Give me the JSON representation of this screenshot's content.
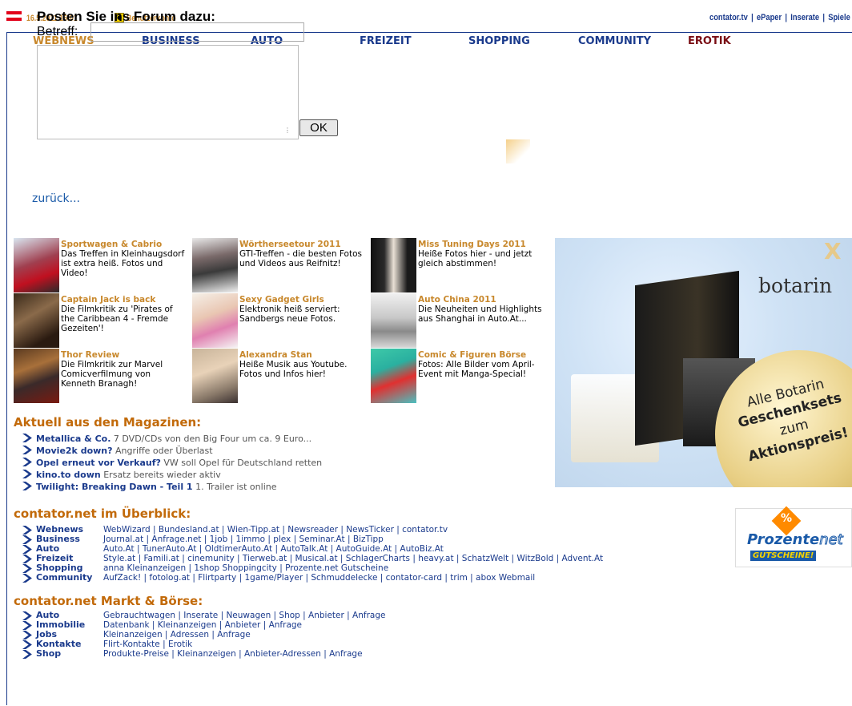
{
  "header": {
    "datetime": "16.5.2011 16:01",
    "account_label": "Benutzerkonto",
    "account_icon": "lock-icon",
    "top_links": [
      "contator.tv",
      "ePaper",
      "Inserate",
      "Spiele"
    ],
    "flag_colors": [
      "#e2001a",
      "#ffffff",
      "#e2001a"
    ]
  },
  "nav": {
    "items": [
      "WEBNEWS",
      "BUSINESS",
      "AUTO",
      "FREIZEIT",
      "SHOPPING",
      "COMMUNITY",
      "EROTIK"
    ],
    "active": "WEBNEWS",
    "accent": "#c8882c",
    "erotik_color": "#7a0d14"
  },
  "forum": {
    "title": "Posten Sie ins Forum dazu:",
    "subject_label": "Betreff:",
    "subject_value": "",
    "body_value": "",
    "submit_label": "OK"
  },
  "back_link": "zurück...",
  "teasers": [
    {
      "title": "Sportwagen & Cabrio",
      "text": "Das Treffen in Kleinhaugsdorf ist extra heiß. Fotos und Video!"
    },
    {
      "title": "Wörtherseetour 2011",
      "text": "GTI-Treffen - die besten Fotos und Videos aus Reifnitz!"
    },
    {
      "title": "Miss Tuning Days 2011",
      "text": "Heiße Fotos hier - und jetzt gleich abstimmen!"
    },
    {
      "title": "Captain Jack is back",
      "text": "Die Filmkritik zu 'Pirates of the Caribbean 4 - Fremde Gezeiten'!"
    },
    {
      "title": "Sexy Gadget Girls",
      "text": "Elektronik heiß serviert: Sandbergs neue Fotos."
    },
    {
      "title": "Auto China 2011",
      "text": "Die Neuheiten und Highlights aus Shanghai in Auto.At..."
    },
    {
      "title": "Thor Review",
      "text": "Die Filmkritik zur Marvel Comicverfilmung von Kenneth Branagh!"
    },
    {
      "title": "Alexandra Stan",
      "text": "Heiße Musik aus Youtube. Fotos und Infos hier!"
    },
    {
      "title": "Comic & Figuren Börse",
      "text": "Fotos: Alle Bilder vom April-Event mit Manga-Special!"
    }
  ],
  "ad": {
    "brand": "botarin",
    "mark": "X",
    "slogan_lines": [
      "Alle Botarin",
      "Geschenksets",
      "zum",
      "Aktionspreis!"
    ]
  },
  "prozente": {
    "sign": "%",
    "word": "Prozente",
    "suffix": "net",
    "badge": "GUTSCHEINE!"
  },
  "magazines": {
    "title": "Aktuell aus den Magazinen:",
    "items": [
      {
        "lead": "Metallica & Co.",
        "rest": "7 DVD/CDs von den Big Four um ca. 9 Euro..."
      },
      {
        "lead": "Movie2k down?",
        "rest": "Angriffe oder Überlast"
      },
      {
        "lead": "Opel erneut vor Verkauf?",
        "rest": "VW soll Opel für Deutschland retten"
      },
      {
        "lead": "kino.to down",
        "rest": "Ersatz bereits wieder aktiv"
      },
      {
        "lead": "Twilight: Breaking Dawn - Teil 1",
        "rest": "1. Trailer ist online"
      }
    ]
  },
  "overview": {
    "title": "contator.net im Überblick:",
    "rows": [
      {
        "lead": "Webnews",
        "links": "WebWizard | Bundesland.at | Wien-Tipp.at | Newsreader | NewsTicker | contator.tv"
      },
      {
        "lead": "Business",
        "links": "Journal.at | Anfrage.net | 1job | 1immo | plex | Seminar.At | BizTipp"
      },
      {
        "lead": "Auto",
        "links": "Auto.At | TunerAuto.At | OldtimerAuto.At | AutoTalk.At | AutoGuide.At | AutoBiz.At"
      },
      {
        "lead": "Freizeit",
        "links": "Style.at | Famili.at | cinemunity | Tierweb.at | Musical.at | SchlagerCharts | heavy.at | SchatzWelt | WitzBold | Advent.At"
      },
      {
        "lead": "Shopping",
        "links": "anna Kleinanzeigen | 1shop Shoppingcity | Prozente.net Gutscheine"
      },
      {
        "lead": "Community",
        "links": "AufZack! | fotolog.at | Flirtparty | 1game/Player | Schmuddelecke | contator-card | trim | abox Webmail"
      }
    ]
  },
  "market": {
    "title": "contator.net Markt & Börse:",
    "rows": [
      {
        "lead": "Auto",
        "links": "Gebrauchtwagen | Inserate | Neuwagen | Shop | Anbieter | Anfrage"
      },
      {
        "lead": "Immobilie",
        "links": "Datenbank | Kleinanzeigen | Anbieter | Anfrage"
      },
      {
        "lead": "Jobs",
        "links": "Kleinanzeigen | Adressen | Anfrage"
      },
      {
        "lead": "Kontakte",
        "links": "Flirt-Kontakte | Erotik"
      },
      {
        "lead": "Shop",
        "links": "Produkte-Preise | Kleinanzeigen | Anbieter-Adressen | Anfrage"
      }
    ]
  }
}
